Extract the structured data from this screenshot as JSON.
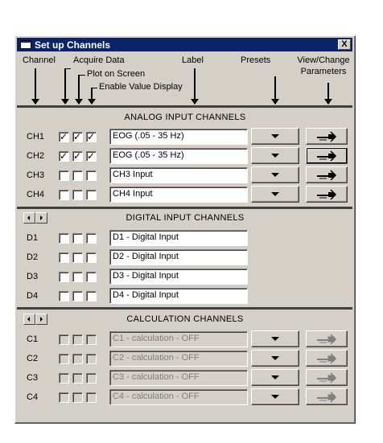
{
  "window": {
    "title": "Set up Channels",
    "close_label": "X"
  },
  "headers": {
    "channel": "Channel",
    "acquire_data": "Acquire Data",
    "plot_on_screen": "Plot on Screen",
    "enable_value_display": "Enable Value Display",
    "label": "Label",
    "presets": "Presets",
    "view_change_line1": "View/Change",
    "view_change_line2": "Parameters"
  },
  "sections": {
    "analog": "ANALOG  INPUT  CHANNELS",
    "digital": "DIGITAL INPUT CHANNELS",
    "calculation": "CALCULATION  CHANNELS"
  },
  "analog": [
    {
      "name": "CH1",
      "acquire": true,
      "plot": true,
      "value": true,
      "label": "EOG (.05 - 35 Hz)"
    },
    {
      "name": "CH2",
      "acquire": true,
      "plot": true,
      "value": true,
      "label": "EOG (.05 - 35 Hz)"
    },
    {
      "name": "CH3",
      "acquire": false,
      "plot": false,
      "value": false,
      "label": "CH3 Input"
    },
    {
      "name": "CH4",
      "acquire": false,
      "plot": false,
      "value": false,
      "label": "CH4 Input"
    }
  ],
  "digital": [
    {
      "name": "D1",
      "label": "D1 - Digital Input"
    },
    {
      "name": "D2",
      "label": "D2 - Digital Input"
    },
    {
      "name": "D3",
      "label": "D3 - Digital Input"
    },
    {
      "name": "D4",
      "label": "D4 - Digital Input"
    }
  ],
  "calculation": [
    {
      "name": "C1",
      "label": "C1 - calculation - OFF"
    },
    {
      "name": "C2",
      "label": "C2 - calculation - OFF"
    },
    {
      "name": "C3",
      "label": "C3 - calculation - OFF"
    },
    {
      "name": "C4",
      "label": "C4 - calculation - OFF"
    }
  ],
  "colors": {
    "titlebar": "#0a246a",
    "face": "#d4d0c8"
  },
  "icons": {
    "presets": "dropdown-arrow-icon",
    "parameters": "wrench-icon",
    "scroll": "scroll-arrow-icon"
  }
}
